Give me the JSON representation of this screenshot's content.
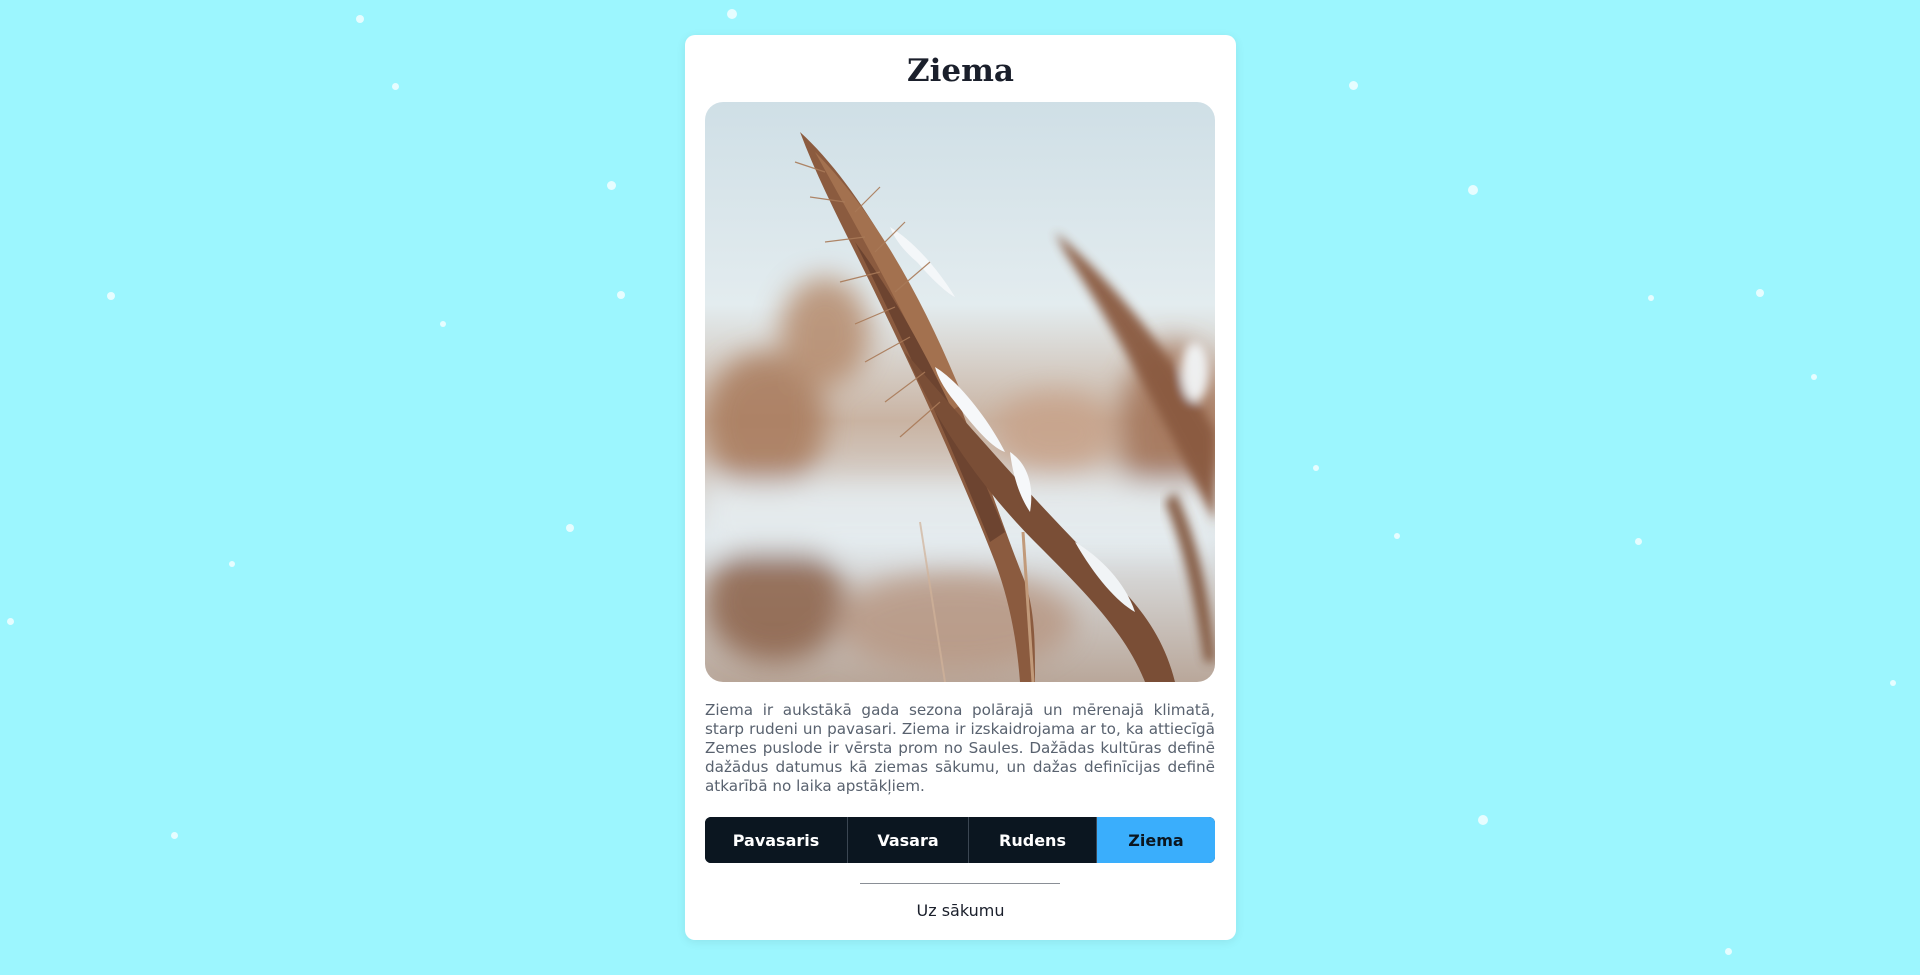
{
  "page": {
    "background_color": "#9cf6fe"
  },
  "card": {
    "title": "Ziema",
    "image_icon": "snowy-reed-grass-photo",
    "description": "Ziema ir aukstākā gada sezona polārajā un mērenajā klimatā, starp rudeni un pavasari. Ziema ir izskaidrojama ar to, ka attiecīgā Zemes puslode ir vērsta prom no Saules. Dažādas kultūras definē dažādus datumus kā ziemas sākumu, un dažas definīcijas definē atkarībā no laika apstākļiem.",
    "home_link": "Uz sākumu"
  },
  "seasons": {
    "tabs": [
      {
        "label": "Pavasaris",
        "active": false
      },
      {
        "label": "Vasara",
        "active": false
      },
      {
        "label": "Rudens",
        "active": false
      },
      {
        "label": "Ziema",
        "active": true
      }
    ],
    "active_color": "#3aaefc",
    "inactive_color": "#0b1620"
  }
}
